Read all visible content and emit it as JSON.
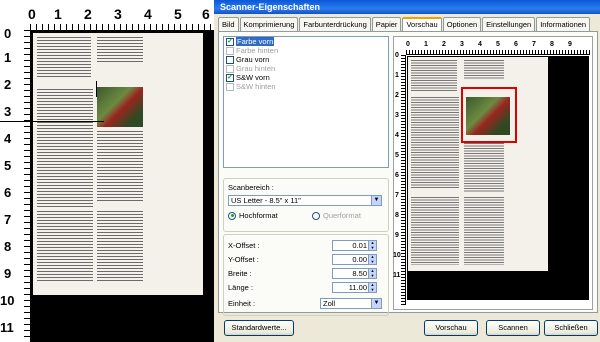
{
  "left_preview": {
    "ruler_top": [
      "0",
      "1",
      "2",
      "3",
      "4",
      "5",
      "6"
    ],
    "ruler_left": [
      "0",
      "1",
      "2",
      "3",
      "4",
      "5",
      "6",
      "7",
      "8",
      "9",
      "10",
      "11"
    ]
  },
  "dialog": {
    "title": "Scanner-Eigenschaften",
    "tabs": [
      "Bild",
      "Komprimierung",
      "Farbunterdrückung",
      "Papier",
      "Vorschau",
      "Optionen",
      "Einstellungen",
      "Informationen"
    ],
    "active_tab": "Vorschau",
    "image_list": [
      {
        "label": "Farbe vorn",
        "checked": true,
        "enabled": true,
        "selected": true
      },
      {
        "label": "Farbe hinten",
        "checked": false,
        "enabled": false,
        "selected": false
      },
      {
        "label": "Grau vorn",
        "checked": false,
        "enabled": true,
        "selected": false
      },
      {
        "label": "Grau hinten",
        "checked": false,
        "enabled": false,
        "selected": false
      },
      {
        "label": "S&W vorn",
        "checked": true,
        "enabled": true,
        "selected": false
      },
      {
        "label": "S&W hinten",
        "checked": false,
        "enabled": false,
        "selected": false
      }
    ],
    "scan_area": {
      "label": "Scanbereich :",
      "value": "US Letter - 8.5\" x 11\"",
      "orientation_portrait": "Hochformat",
      "orientation_landscape": "Querformat"
    },
    "offsets": {
      "x_label": "X-Offset :",
      "x_value": "0.01",
      "y_label": "Y-Offset :",
      "y_value": "0.00",
      "width_label": "Breite :",
      "width_value": "8.50",
      "length_label": "Länge :",
      "length_value": "11.00",
      "unit_label": "Einheit :",
      "unit_value": "Zoll"
    },
    "preview_ruler_top": [
      "0",
      "1",
      "2",
      "3",
      "4",
      "5",
      "6",
      "7",
      "8",
      "9"
    ],
    "preview_ruler_left": [
      "0",
      "1",
      "2",
      "3",
      "4",
      "5",
      "6",
      "7",
      "8",
      "9",
      "10",
      "11"
    ],
    "buttons": {
      "defaults": "Standardwerte...",
      "preview": "Vorschau",
      "scan": "Scannen",
      "close": "Schließen"
    },
    "colors": {
      "selection_frame": "#e00000",
      "titlebar": "#0a58d6"
    }
  }
}
